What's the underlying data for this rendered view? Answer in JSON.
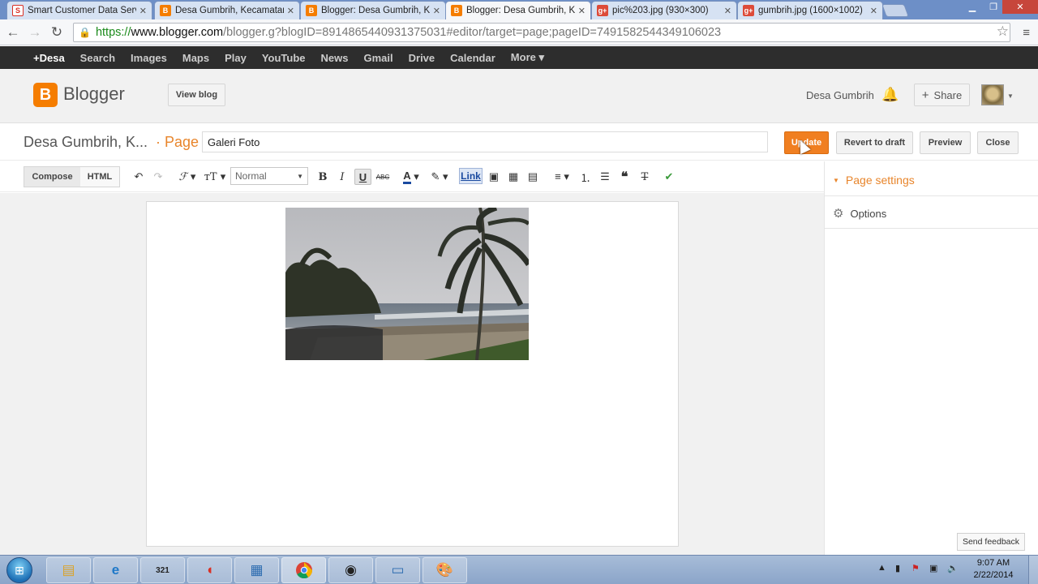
{
  "browser": {
    "tabs": [
      {
        "title": "Smart Customer Data Serv",
        "favicon": "S",
        "color": "#d93025"
      },
      {
        "title": "Desa Gumbrih, Kecamatan",
        "favicon": "B",
        "color": "#f57d00"
      },
      {
        "title": "Blogger: Desa Gumbrih, K",
        "favicon": "B",
        "color": "#f57d00"
      },
      {
        "title": "Blogger: Desa Gumbrih, K",
        "favicon": "B",
        "color": "#f57d00"
      },
      {
        "title": "pic%203.jpg (930×300)",
        "favicon": "g+",
        "color": "#dd4b39"
      },
      {
        "title": "gumbrih.jpg (1600×1002)",
        "favicon": "g+",
        "color": "#dd4b39"
      }
    ],
    "url_scheme": "https://",
    "url_host": "www.blogger.com",
    "url_rest": "/blogger.g?blogID=8914865440931375031#editor/target=page;pageID=7491582544349106023"
  },
  "gbar": {
    "items": [
      "+Desa",
      "Search",
      "Images",
      "Maps",
      "Play",
      "YouTube",
      "News",
      "Gmail",
      "Drive",
      "Calendar",
      "More ▾"
    ]
  },
  "blogger": {
    "logo_letter": "B",
    "name": "Blogger",
    "view_blog": "View blog",
    "username": "Desa Gumbrih",
    "share": "Share"
  },
  "editor": {
    "blog_title": "Desa Gumbrih, K...",
    "page_label": "· Page",
    "page_title_value": "Galeri Foto",
    "update": "Update",
    "revert": "Revert to draft",
    "preview": "Preview",
    "close": "Close",
    "compose": "Compose",
    "html": "HTML",
    "font_size": "Normal",
    "link": "Link"
  },
  "sidebar": {
    "page_settings": "Page settings",
    "options": "Options"
  },
  "feedback": "Send feedback",
  "taskbar": {
    "time": "9:07 AM",
    "date": "2/22/2014"
  }
}
